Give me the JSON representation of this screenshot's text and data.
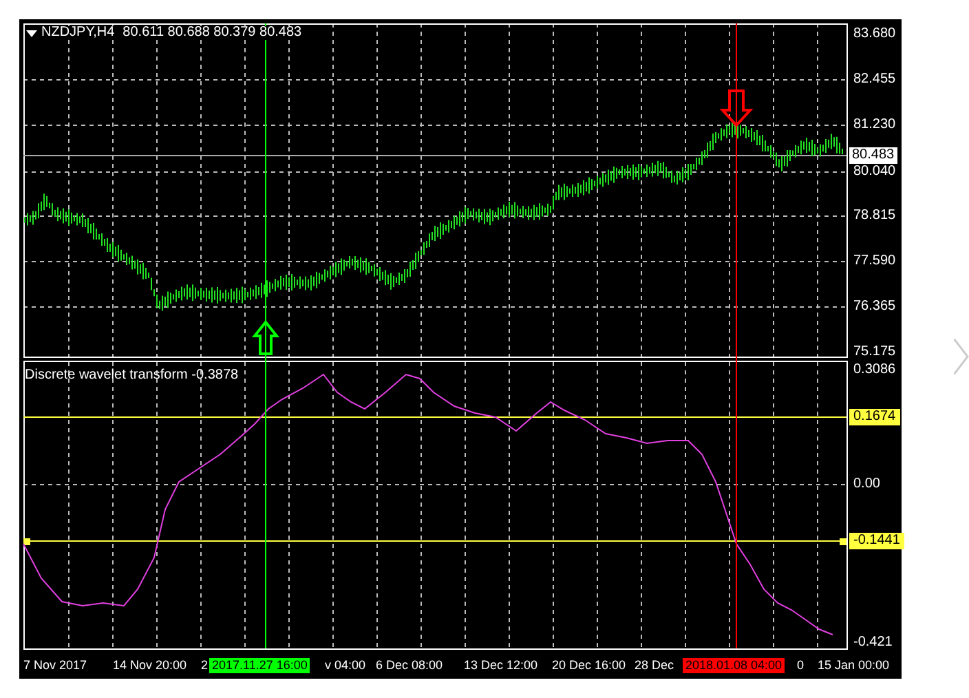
{
  "chart": {
    "symbol": "NZDJPY,H4",
    "ohlc": "80.611 80.688 80.379 80.483",
    "current_price": "80.483",
    "price_axis": [
      "83.680",
      "82.455",
      "81.230",
      "80.040",
      "78.815",
      "77.590",
      "76.365",
      "75.175"
    ]
  },
  "indicator": {
    "title": "Discrete wavelet transform -0.3878",
    "axis": [
      "0.3086",
      "0.00",
      "-0.421"
    ],
    "levels": [
      {
        "label": "0.1674"
      },
      {
        "label": "-0.1441"
      }
    ]
  },
  "time_axis": [
    "7 Nov 2017",
    "14 Nov 20:00",
    "2",
    "v 04:00",
    "6 Dec 08:00",
    "13 Dec 12:00",
    "20 Dec 16:00",
    "28 Dec",
    "0",
    "15 Jan 00:00"
  ],
  "markers": [
    {
      "label": "2017.11.27 16:00",
      "color": "#00ff00",
      "kind": "buy"
    },
    {
      "label": "2018.01.08 04:00",
      "color": "#ff0000",
      "kind": "sell"
    }
  ]
}
